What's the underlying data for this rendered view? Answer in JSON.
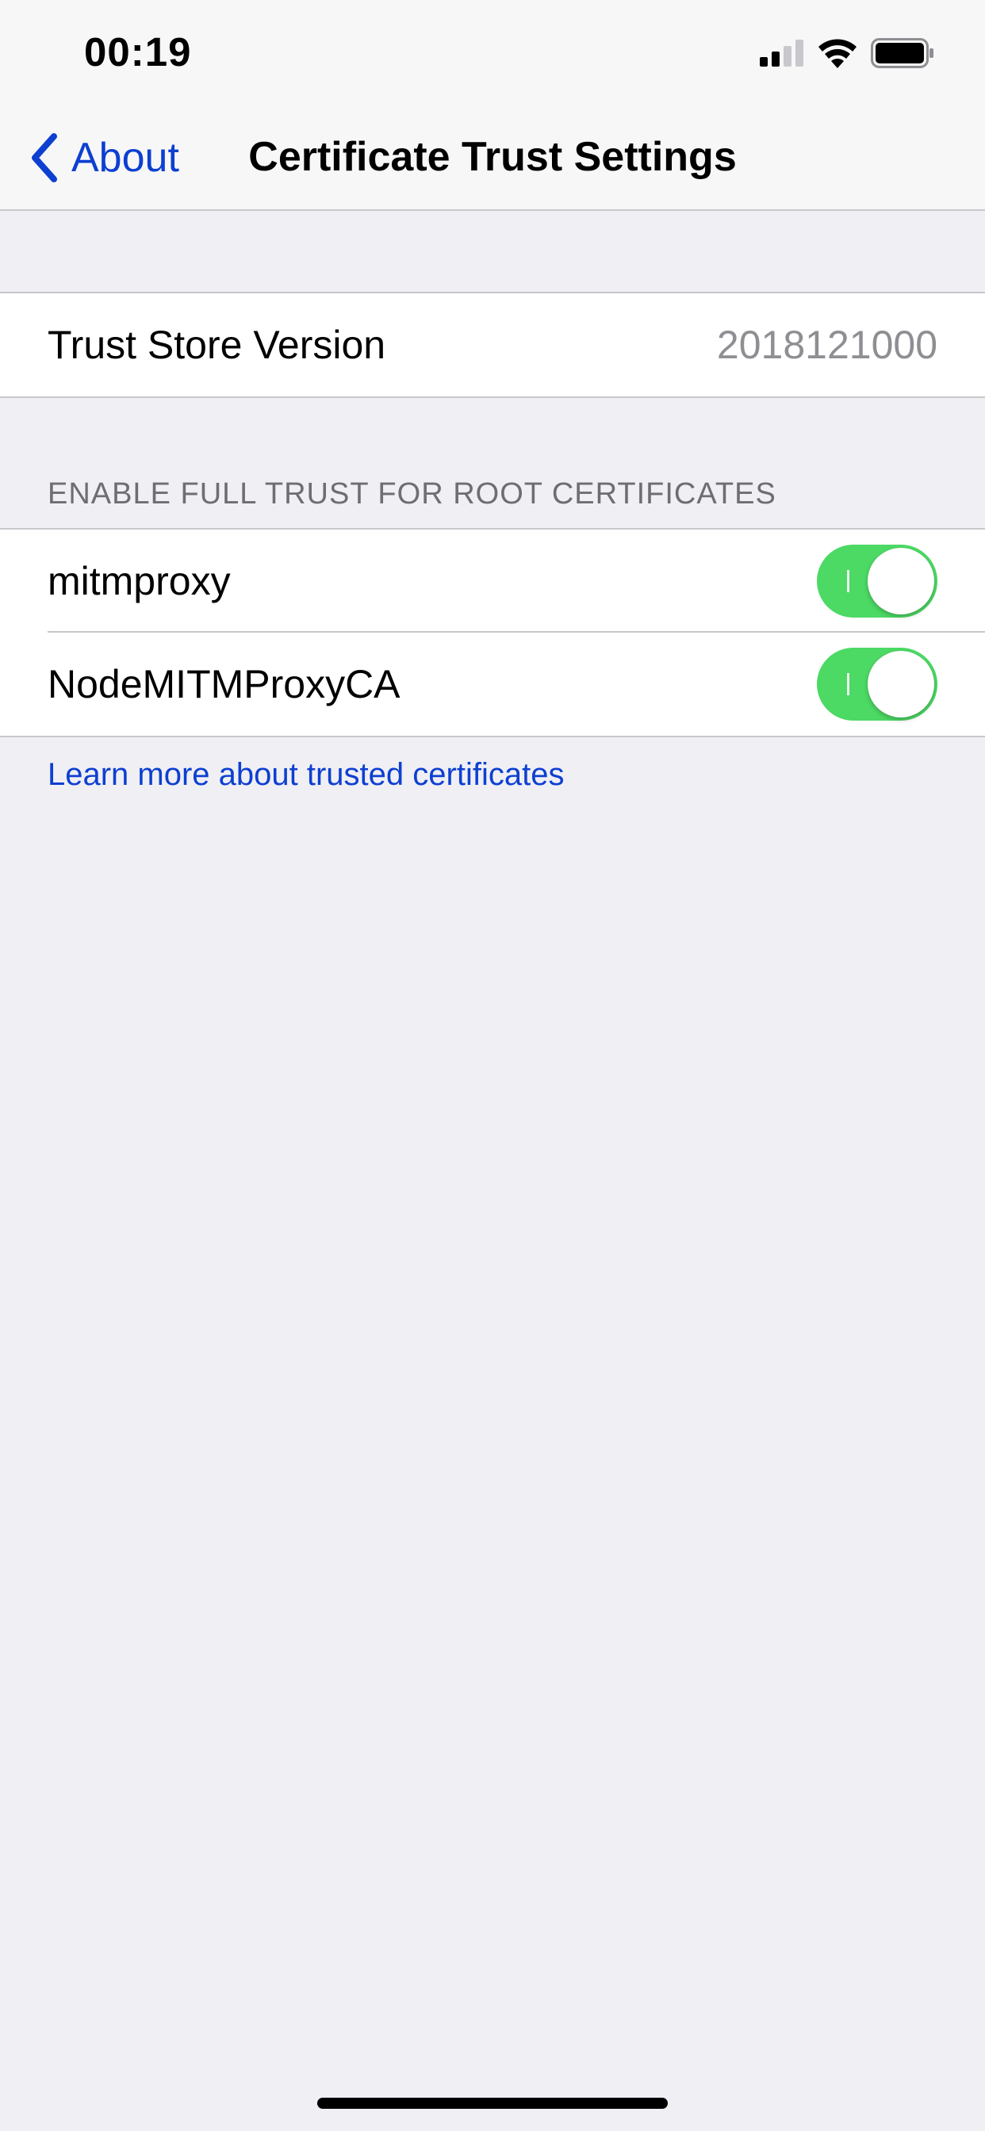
{
  "status_bar": {
    "time": "00:19",
    "signal_icon": "cellular-signal-icon",
    "wifi_icon": "wifi-icon",
    "battery_icon": "battery-icon"
  },
  "navbar": {
    "back_label": "About",
    "back_icon": "chevron-left-icon",
    "title": "Certificate Trust Settings"
  },
  "trust_store": {
    "label": "Trust Store Version",
    "value": "2018121000"
  },
  "root_certificates": {
    "header": "ENABLE FULL TRUST FOR ROOT CERTIFICATES",
    "items": [
      {
        "label": "mitmproxy",
        "enabled": true
      },
      {
        "label": "NodeMITMProxyCA",
        "enabled": true
      }
    ],
    "learn_more": "Learn more about trusted certificates"
  },
  "colors": {
    "accent": "#0d3fd1",
    "toggle_on": "#4cd964",
    "background": "#efeff4",
    "secondary_text": "#8e8e93"
  }
}
